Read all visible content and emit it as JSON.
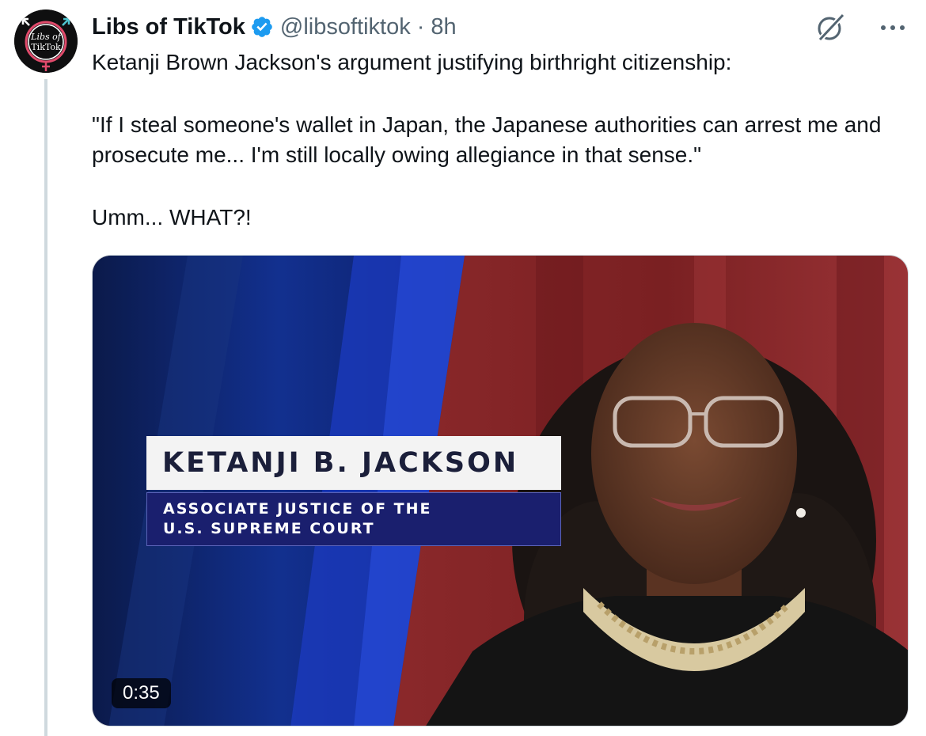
{
  "tweet": {
    "author": {
      "display_name": "Libs of TikTok",
      "handle": "@libsoftiktok",
      "separator": "·",
      "time": "8h",
      "avatar_text_line1": "Libs of",
      "avatar_text_line2": "TikTok",
      "verified": true
    },
    "text": {
      "line1": "Ketanji Brown Jackson's argument justifying birthright citizenship:",
      "quote": "\"If I steal someone's wallet in Japan, the Japanese authorities can arrest me and prosecute me... I'm still locally owing allegiance in that sense.\"",
      "closing": "Umm... WHAT?!"
    },
    "media": {
      "type": "video",
      "duration": "0:35",
      "lower_third_name": "KETANJI B. JACKSON",
      "lower_third_title_line1": "ASSOCIATE JUSTICE OF THE",
      "lower_third_title_line2": "U.S. SUPREME COURT"
    },
    "icons": {
      "verified_badge": "verified-badge-icon",
      "grok": "grok-icon",
      "more": "more-icon"
    },
    "colors": {
      "verified_blue": "#1d9bf0",
      "secondary_text": "#536471",
      "primary_text": "#0f1419"
    }
  }
}
